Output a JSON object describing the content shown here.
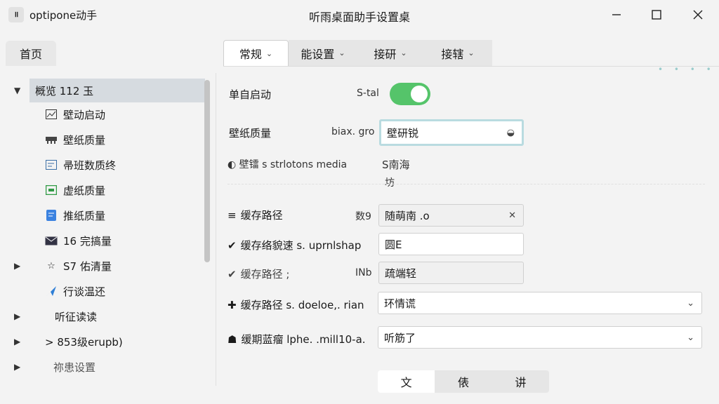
{
  "app": {
    "icon_text": "॥",
    "name": "optipone动手",
    "window_title": "听雨桌面助手设置桌"
  },
  "window_controls": {
    "minimize": "—",
    "maximize": "☐",
    "close": "✕"
  },
  "left_tab": {
    "label": "首页"
  },
  "tabs": [
    {
      "label": "常规",
      "chev": "⌄"
    },
    {
      "label": "能设置",
      "chev": "⌄"
    },
    {
      "label": "接研",
      "chev": "⌄"
    },
    {
      "label": "接辖",
      "chev": "⌄"
    }
  ],
  "top_dots": "• • • •",
  "sidebar": {
    "items": [
      {
        "arrow": "▼",
        "icon": "",
        "label": "概览 112 玉"
      },
      {
        "arrow": "",
        "icon": "📈",
        "label": "壁动启动"
      },
      {
        "arrow": "",
        "icon": "▬",
        "label": "壁纸质量"
      },
      {
        "arrow": "",
        "icon": "📝",
        "label": "帚班数质终"
      },
      {
        "arrow": "",
        "icon": "▣",
        "label": "虚纸质量"
      },
      {
        "arrow": "",
        "icon": "▤",
        "label": "推纸质量"
      },
      {
        "arrow": "",
        "icon": "✉",
        "label": "16 完搞量"
      },
      {
        "arrow": "▶",
        "icon": "☆",
        "label": "S7 佑清量"
      },
      {
        "arrow": "",
        "icon": "➤",
        "label": "行谈温还"
      },
      {
        "arrow": "▶",
        "icon": "",
        "label": "听征读读"
      },
      {
        "arrow": "▶",
        "icon": "",
        "label": "> 853级erupb)"
      },
      {
        "arrow": "▶",
        "icon": "",
        "label": "祢患设置"
      }
    ]
  },
  "main": {
    "startup": {
      "label": "单自启动",
      "mid": "S-tal"
    },
    "quality": {
      "label": "壁纸质量",
      "mid": "biax. gro",
      "value": "壁研锐",
      "end_icon": "◒"
    },
    "row3": {
      "label": "◐ 壁镭 s strlotons media",
      "mid": "S南海",
      "sub": "坊"
    },
    "cache1": {
      "icon": "≡",
      "label": "缓存路径",
      "mid": "数9",
      "value": "随萌南 .o",
      "end_icon": "✕"
    },
    "cache2": {
      "icon": "✔",
      "label": "缓存络貌速 s. uprnlshap",
      "value": "圆E"
    },
    "cache3": {
      "icon": "✔",
      "label": "缓存路径 ;",
      "mid": "INb",
      "value": "疏端轻"
    },
    "cache4": {
      "icon": "✚",
      "label": "缓存路径 s. doeloe,. rian",
      "value": "环情谎",
      "end_icon": "⌄"
    },
    "cache5": {
      "icon": "☗",
      "label": "缓期蓝瘤 lphe. .mill10-a.",
      "value": "听筋了",
      "end_icon": "⌄"
    }
  },
  "segmented": {
    "items": [
      "文",
      "俵",
      "讲"
    ]
  },
  "colors": {
    "toggle_on": "#55c46a",
    "selected_row": "#d6dbe0",
    "focus_ring": "#b9dbe0"
  }
}
